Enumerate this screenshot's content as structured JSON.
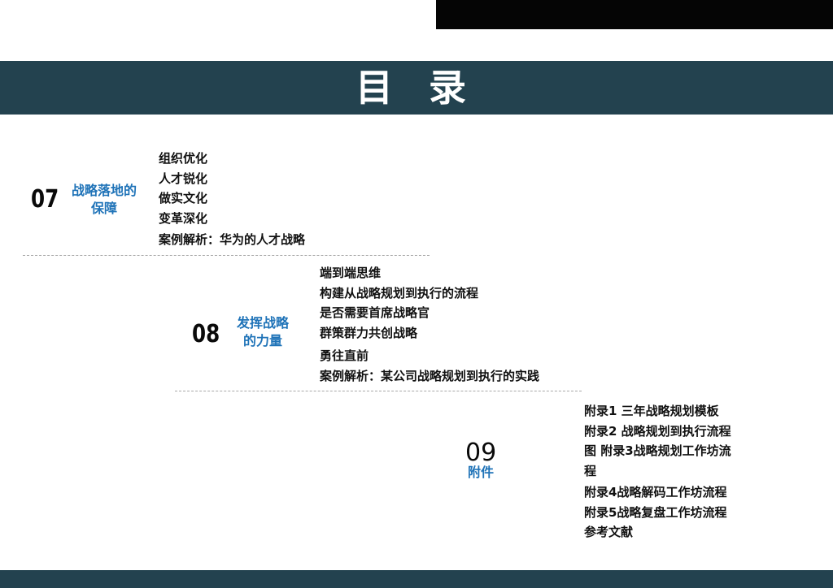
{
  "header": {
    "title": "目 录"
  },
  "sections": [
    {
      "number": "07",
      "title_line1": "战略落地的",
      "title_line2": "保障",
      "items": [
        "组织优化",
        "人才锐化",
        "做实文化",
        "变革深化",
        "案例解析：华为的人才战略"
      ]
    },
    {
      "number": "08",
      "title_line1": "发挥战略",
      "title_line2": "的力量",
      "items": [
        "端到端思维",
        "构建从战略规划到执行的流程",
        "是否需要首席战略官",
        "群策群力共创战略",
        "勇往直前",
        "案例解析：某公司战略规划到执行的实践"
      ]
    },
    {
      "number": "09",
      "title_line1": "附件",
      "items": [
        "附录1  三年战略规划模板",
        "附录2  战略规划到执行流程",
        "图  附录3战略规划工作坊流",
        "程",
        "附录4战略解码工作坊流程",
        "附录5战略复盘工作坊流程",
        "参考文献"
      ]
    }
  ],
  "colors": {
    "band": "#23424f",
    "accent_blue": "#1f73b8",
    "top_bar": "#050505"
  }
}
